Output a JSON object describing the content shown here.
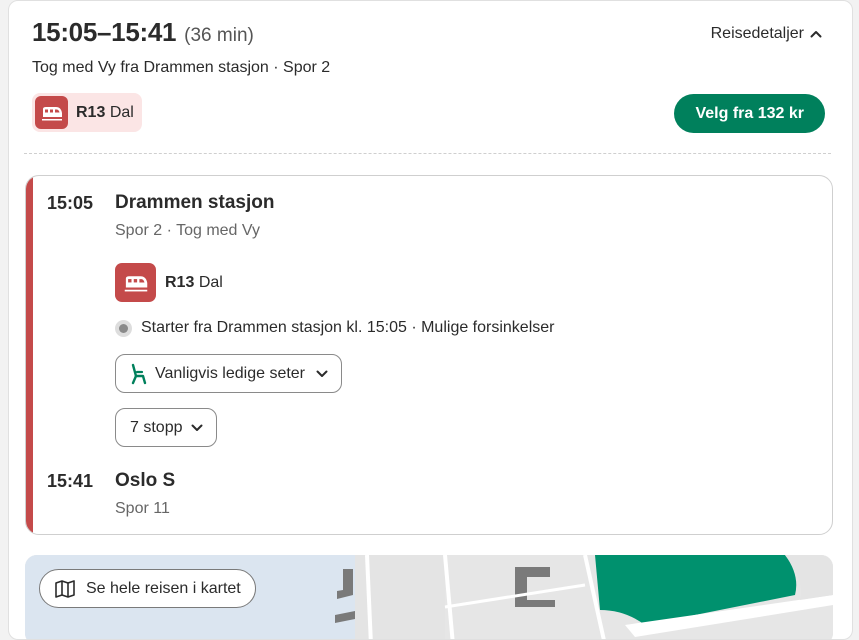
{
  "header": {
    "time_range": "15:05–15:41",
    "duration": "(36 min)",
    "details_label": "Reisedetaljer",
    "subtitle": "Tog med Vy fra Drammen stasjon · Spor 2",
    "line_code": "R13",
    "line_name": "Dal",
    "select_label": "Velg fra 132 kr"
  },
  "leg": {
    "departure": {
      "time": "15:05",
      "name": "Drammen stasjon",
      "sub": "Spor 2 · Tog med Vy"
    },
    "line_code": "R13",
    "line_name": "Dal",
    "info": "Starter fra Drammen stasjon kl. 15:05 · Mulige forsinkelser",
    "seats_label": "Vanligvis ledige seter",
    "stops_label": "7 stopp",
    "arrival": {
      "time": "15:41",
      "name": "Oslo S",
      "sub": "Spor 11"
    }
  },
  "map": {
    "button_label": "Se hele reisen i kartet"
  },
  "colors": {
    "train": "#c44a4a",
    "chip_bg": "#fbe5e5",
    "accent_green": "#00805c",
    "park_green": "#00916e",
    "water": "#dbe5f0"
  },
  "icons": [
    "train-icon",
    "chevron-up-icon",
    "seat-icon",
    "chevron-down-icon",
    "map-icon"
  ]
}
